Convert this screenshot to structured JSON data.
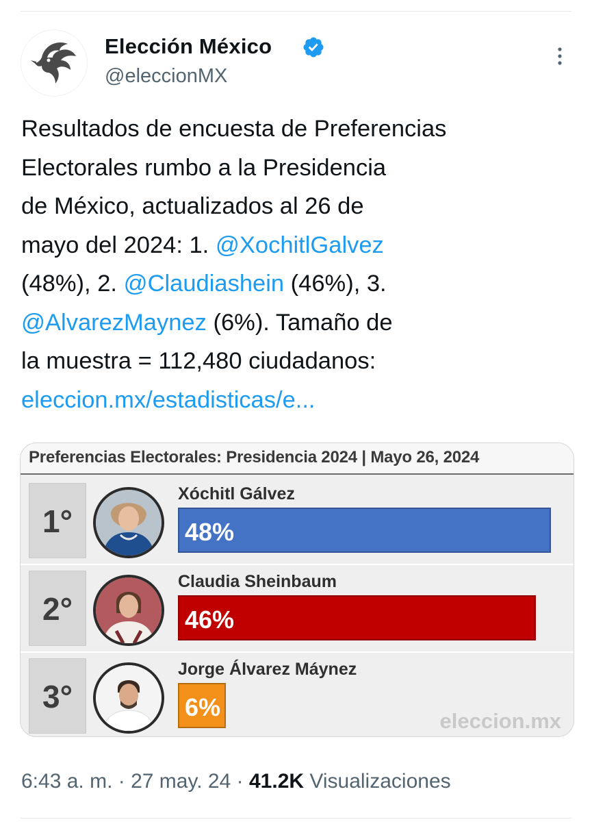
{
  "account": {
    "display_name": "Elección México",
    "handle": "@eleccionMX"
  },
  "tweet": {
    "text_before_1": "Resultados de encuesta de Preferencias",
    "text_before_2": "Electorales rumbo a la Presidencia",
    "text_before_3": "de México, actualizados al 26 de",
    "text_before_4": "mayo del 2024: 1.",
    "mention_1": "@XochitlGalvez",
    "pct_1_text": "(48%), 2.",
    "mention_2": "@Claudiashein",
    "pct_2_text": "(46%), 3.",
    "mention_3": "@AlvarezMaynez",
    "pct_3_text": "(6%). Tamaño de",
    "sample_text": "la muestra = 112,480 ciudadanos:",
    "link": "eleccion.mx/estadisticas/e..."
  },
  "card": {
    "title": "Preferencias Electorales: Presidencia 2024 | Mayo 26, 2024",
    "watermark": "eleccion.mx",
    "rows": [
      {
        "rank": "1°",
        "name": "Xóchitl Gálvez",
        "pct_label": "48%"
      },
      {
        "rank": "2°",
        "name": "Claudia Sheinbaum",
        "pct_label": "46%"
      },
      {
        "rank": "3°",
        "name": "Jorge Álvarez Máynez",
        "pct_label": "6%"
      }
    ]
  },
  "chart_data": {
    "type": "bar",
    "title": "Preferencias Electorales: Presidencia 2024 | Mayo 26, 2024",
    "categories": [
      "Xóchitl Gálvez",
      "Claudia Sheinbaum",
      "Jorge Álvarez Máynez"
    ],
    "values": [
      48,
      46,
      6
    ],
    "colors": [
      "#4472c4",
      "#c00000",
      "#f39019"
    ],
    "orientation": "horizontal",
    "ylim": [
      0,
      50
    ]
  },
  "meta": {
    "time": "6:43 a. m.",
    "sep1": "·",
    "date": "27 may. 24",
    "sep2": "·",
    "views_count": "41.2K",
    "views_label": "Visualizaciones"
  },
  "colors": {
    "link": "#1d9bf0",
    "verified": "#1d9bf0",
    "muted": "#536471"
  }
}
